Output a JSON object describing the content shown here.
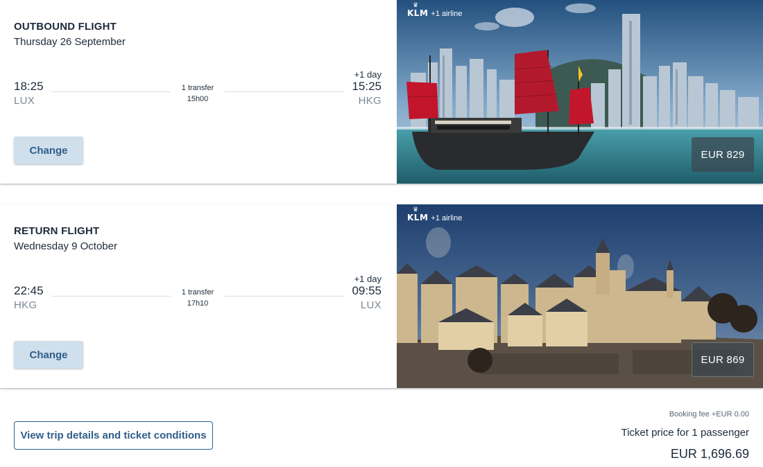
{
  "outbound": {
    "title": "OUTBOUND FLIGHT",
    "date": "Thursday 26 September",
    "departure_time": "18:25",
    "departure_code": "LUX",
    "transfer": "1 transfer",
    "duration": "15h00",
    "plus_day": "+1 day",
    "arrival_time": "15:25",
    "arrival_code": "HKG",
    "change_label": "Change",
    "airline_logo": "KLM",
    "airline_extra": "+1 airline",
    "price": "EUR 829",
    "image_icon": "hong-kong-junk-photo"
  },
  "return": {
    "title": "RETURN FLIGHT",
    "date": "Wednesday 9 October",
    "departure_time": "22:45",
    "departure_code": "HKG",
    "transfer": "1 transfer",
    "duration": "17h10",
    "plus_day": "+1 day",
    "arrival_time": "09:55",
    "arrival_code": "LUX",
    "change_label": "Change",
    "airline_logo": "KLM",
    "airline_extra": "+1 airline",
    "price": "EUR 869",
    "image_icon": "luxembourg-old-town-photo"
  },
  "footer": {
    "details_label": "View trip details and ticket conditions",
    "booking_fee": "Booking fee +EUR 0.00",
    "price_label": "Ticket price for 1 passenger",
    "total": "EUR 1,696.69"
  },
  "colors": {
    "primary": "#2f5e8a",
    "button_bg": "#cfdfec",
    "text": "#1d2a3a",
    "muted": "#7a8694"
  }
}
